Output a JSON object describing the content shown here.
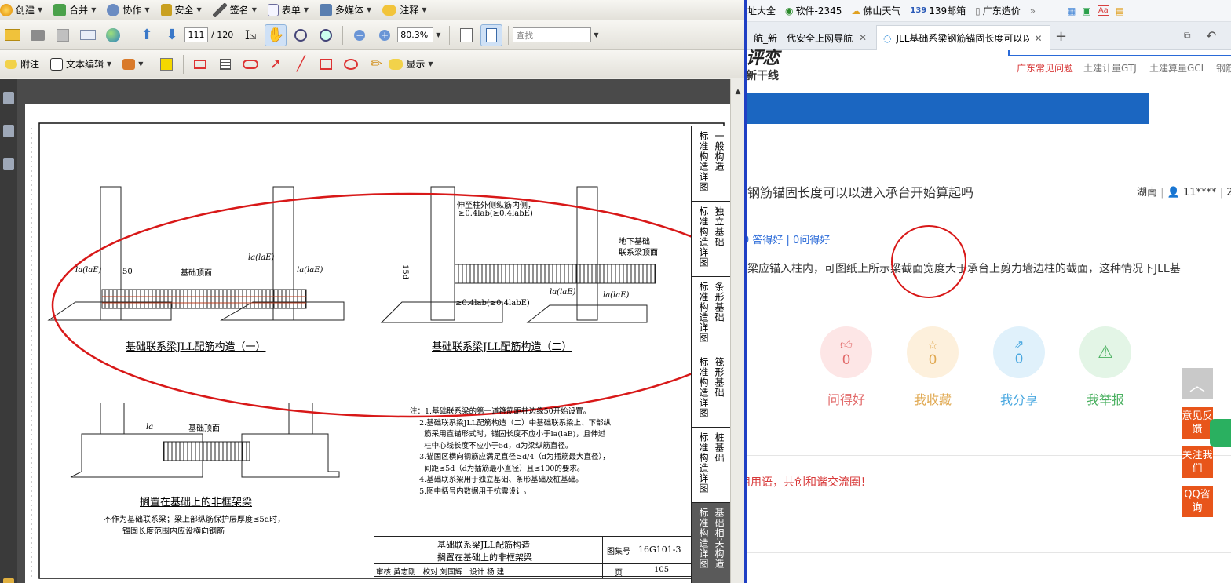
{
  "pdf": {
    "menubar": [
      {
        "label": "创建",
        "icon": "create-icon"
      },
      {
        "label": "合并",
        "icon": "combine-icon"
      },
      {
        "label": "协作",
        "icon": "collaborate-icon"
      },
      {
        "label": "安全",
        "icon": "lock-icon"
      },
      {
        "label": "签名",
        "icon": "pen-icon"
      },
      {
        "label": "表单",
        "icon": "form-icon"
      },
      {
        "label": "多媒体",
        "icon": "multimedia-icon"
      },
      {
        "label": "注释",
        "icon": "comment-icon"
      }
    ],
    "toolbar": {
      "page_current": "111",
      "page_total": "/ 120",
      "zoom": "80.3%",
      "search_placeholder": "查找"
    },
    "annotbar": {
      "attach": "附注",
      "text_edit": "文本编辑",
      "show": "显示"
    },
    "page": {
      "right_tabs": [
        {
          "left": "标准构造详图",
          "right": "一般构造"
        },
        {
          "left": "标准构造详图",
          "right": "独立基础"
        },
        {
          "left": "标准构造详图",
          "right": "条形基础"
        },
        {
          "left": "标准构造详图",
          "right": "筏形基础"
        },
        {
          "left": "标准构造详图",
          "right": "桩基础"
        },
        {
          "left": "标准构造详图",
          "right": "基础相关构造"
        }
      ],
      "drawing1_title": "基础联系梁JLL配筋构造（一）",
      "drawing2_title": "基础联系梁JLL配筋构造（二）",
      "drawing3_title": "搁置在基础上的非框架梁",
      "drawing3_note1": "不作为基础联系梁；梁上部纵筋保护层厚度≤5d时，",
      "drawing3_note2": "锚固长度范围内应设横向钢筋",
      "labels": {
        "found_top": "基础顶面",
        "found_top2": "基础顶面",
        "extend_note1": "伸至柱外侧纵筋内侧，",
        "extend_note2": "≥0.4lab(≥0.4labE)",
        "extend_note3": "≥0.4lab(≥0.4labE)",
        "ground_note1": "地下基础",
        "ground_note2": "联系梁顶面",
        "la1": "la(laE)",
        "la2": "la(laE)",
        "la3": "la(laE)",
        "la4": "la(laE)",
        "la5": "la(laE)",
        "la_short": "la",
        "fifty": "50",
        "fifteen_d": "15d"
      },
      "notes": [
        "注：1.基础联系梁的第一道箍筋距柱边缘50开始设置。",
        "    2.基础联系梁JLL配筋构造（二）中基础联系梁上、下部纵",
        "      筋采用直锚形式时，锚固长度不应小于la(laE)，且伸过",
        "      柱中心线长度不应小于5d，d为梁纵筋直径。",
        "    3.锚固区横向钢筋应满足直径≥d/4（d为插筋最大直径），",
        "      间距≤5d（d为插筋最小直径）且≤100的要求。",
        "    4.基础联系梁用于独立基础、条形基础及桩基础。",
        "    5.图中括号内数据用于抗震设计。"
      ],
      "titleblock": {
        "title1": "基础联系梁JLL配筋构造",
        "title2": "搁置在基础上的非框架梁",
        "atlas_label": "图集号",
        "atlas_no": "16G101-3",
        "page_label": "页",
        "page_no": "105",
        "sign_row": "审核 黄志刚   校对 刘国辉   设计 杨 建"
      }
    }
  },
  "browser": {
    "favorites": [
      {
        "label": "址大全"
      },
      {
        "label": "软件-2345"
      },
      {
        "label": "佛山天气"
      },
      {
        "label": "139邮箱"
      },
      {
        "label": "广东造价"
      }
    ],
    "tabs": [
      {
        "label": "航_新一代安全上网导航"
      },
      {
        "label": "JLL基础系梁钢筋锚固长度可以以"
      }
    ],
    "site": {
      "logo_top": "评恋",
      "logo_sub": "新干线",
      "nav": [
        "广东常见问题",
        "土建计量GTJ",
        "土建算量GCL",
        "钢筋"
      ],
      "question_title": "钢筋锚固长度可以以进入承台开始算起吗",
      "asker_region": "湖南",
      "asker_user": "11****",
      "asker_date": "20",
      "stats": "0 答得好 | 0问得好",
      "question_body": "梁应锚入柱内，可图纸上所示梁截面宽度大于承台上剪力墙边柱的截面，这种情况下JLL基",
      "actions": [
        {
          "label": "问得好",
          "count": "0",
          "icon": "thumbs-up-icon"
        },
        {
          "label": "我收藏",
          "count": "0",
          "icon": "star-icon"
        },
        {
          "label": "我分享",
          "count": "0",
          "icon": "share-icon"
        },
        {
          "label": "我举报",
          "count": "",
          "icon": "warning-icon"
        }
      ],
      "civil_note": "用用语，共创和谐交流圈！",
      "side_buttons": [
        "意见反馈",
        "关注我们",
        "QQ咨询"
      ]
    }
  }
}
